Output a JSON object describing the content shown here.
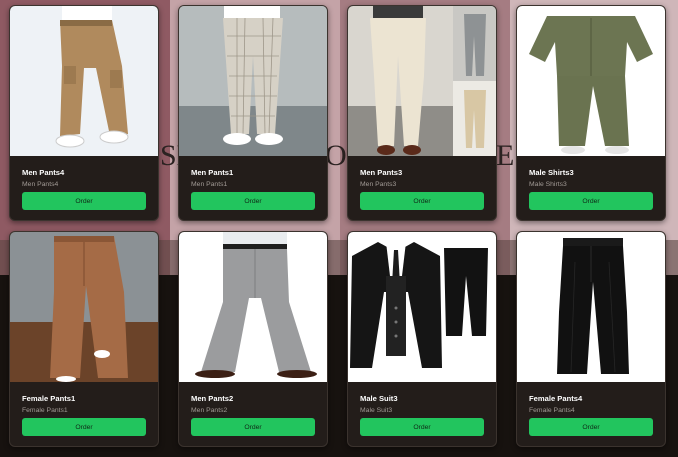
{
  "products": [
    {
      "title": "Men Pants4",
      "subtitle": "Men Pants4",
      "button": "Order",
      "image": "khaki-cargo-pants-photo"
    },
    {
      "title": "Men Pants1",
      "subtitle": "Men Pants1",
      "button": "Order",
      "image": "plaid-trousers-photo"
    },
    {
      "title": "Men Pants3",
      "subtitle": "Men Pants3",
      "button": "Order",
      "image": "beige-dress-pants-collage-photo"
    },
    {
      "title": "Male Shirts3",
      "subtitle": "Male Shirts3",
      "button": "Order",
      "image": "olive-shirt-set-photo"
    },
    {
      "title": "Female Pants1",
      "subtitle": "Female Pants1",
      "button": "Order",
      "image": "brown-wide-leg-pants-photo"
    },
    {
      "title": "Men Pants2",
      "subtitle": "Men Pants2",
      "button": "Order",
      "image": "grey-flared-trousers-photo"
    },
    {
      "title": "Male Suit3",
      "subtitle": "Male Suit3",
      "button": "Order",
      "image": "black-three-piece-suit-photo"
    },
    {
      "title": "Female Pants4",
      "subtitle": "Female Pants4",
      "button": "Order",
      "image": "black-wide-leg-pants-photo"
    }
  ],
  "colors": {
    "card_bg": "#231d1a",
    "button_green": "#22c55e",
    "title_text": "#ffffff",
    "subtitle_text": "#a19a95"
  }
}
